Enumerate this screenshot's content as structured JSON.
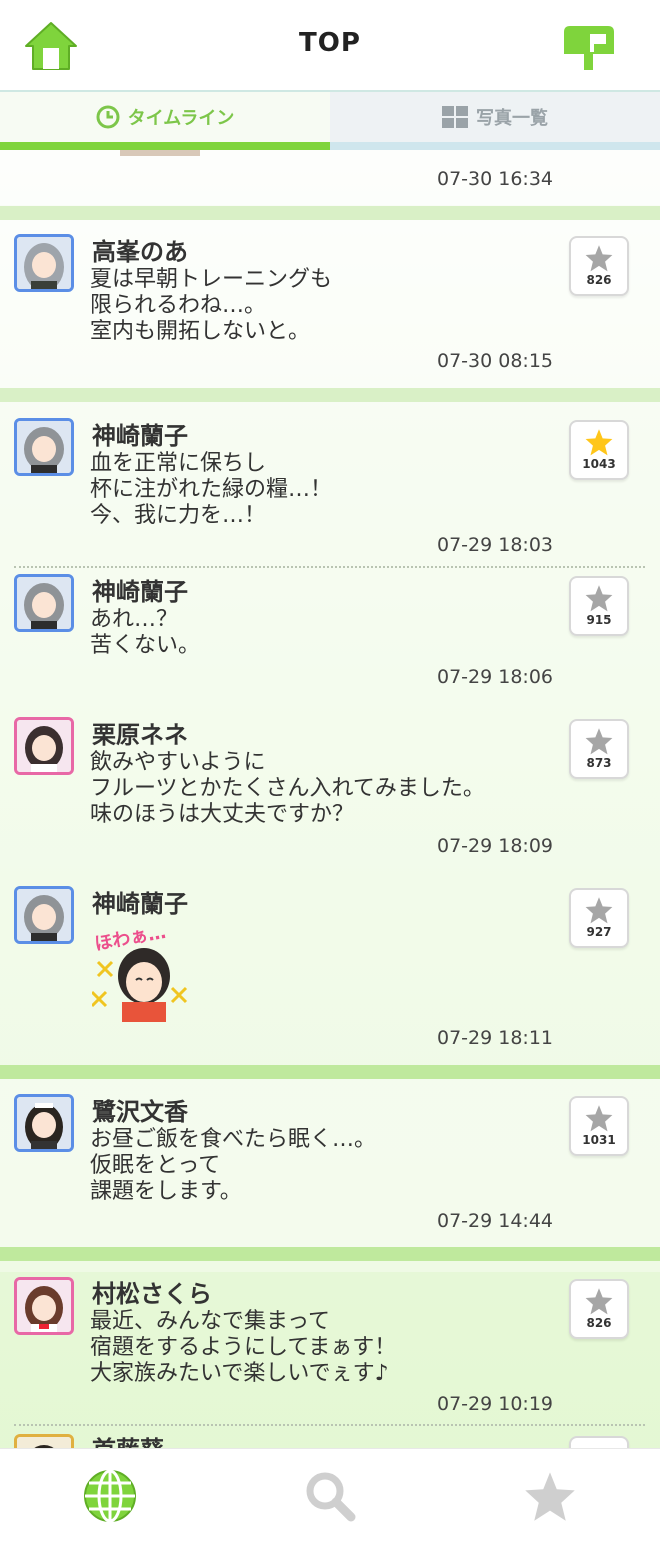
{
  "header": {
    "title": "TOP"
  },
  "tabs": [
    {
      "label": "タイムライン",
      "active": true
    },
    {
      "label": "写真一覧",
      "active": false
    }
  ],
  "colors": {
    "accent": "#7fd43c",
    "star_active": "#ffc61a",
    "star_inactive": "#a6a6a6",
    "avatar_blue": "#5b8ee6",
    "avatar_pink": "#e868a6"
  },
  "posts": [
    {
      "name": "",
      "message": "",
      "time": "07-30 16:34"
    },
    {
      "name": "高峯のあ",
      "message": "夏は早朝トレーニングも\n限られるわね…。\n室内も開拓しないと。",
      "time": "07-30 08:15",
      "likes": "826",
      "liked": false
    },
    {
      "name": "神崎蘭子",
      "message": "血を正常に保ちし\n杯に注がれた緑の糧…！\n今、我に力を…！",
      "time": "07-29 18:03",
      "likes": "1043",
      "liked": true
    },
    {
      "name": "神崎蘭子",
      "message": "あれ…？\n苦くない。",
      "time": "07-29 18:06",
      "likes": "915",
      "liked": false
    },
    {
      "name": "栗原ネネ",
      "message": "飲みやすいように\nフルーツとかたくさん入れてみました。\n味のほうは大丈夫ですか？",
      "time": "07-29 18:09",
      "likes": "873",
      "liked": false
    },
    {
      "name": "神崎蘭子",
      "sticker_text": "ほわぁ…",
      "time": "07-29 18:11",
      "likes": "927",
      "liked": false
    },
    {
      "name": "鷺沢文香",
      "message": "お昼ご飯を食べたら眠く…。\n仮眠をとって\n課題をします。",
      "time": "07-29 14:44",
      "likes": "1031",
      "liked": false
    },
    {
      "name": "村松さくら",
      "message": "最近、みんなで集まって\n宿題をするようにしてまぁす！\n大家族みたいで楽しいでぇす♪",
      "time": "07-29 10:19",
      "likes": "826",
      "liked": false
    },
    {
      "name": "首藤葵"
    }
  ],
  "bottom_nav": [
    {
      "icon": "globe-icon",
      "active": true
    },
    {
      "icon": "search-icon",
      "active": false
    },
    {
      "icon": "star-icon",
      "active": false
    }
  ]
}
